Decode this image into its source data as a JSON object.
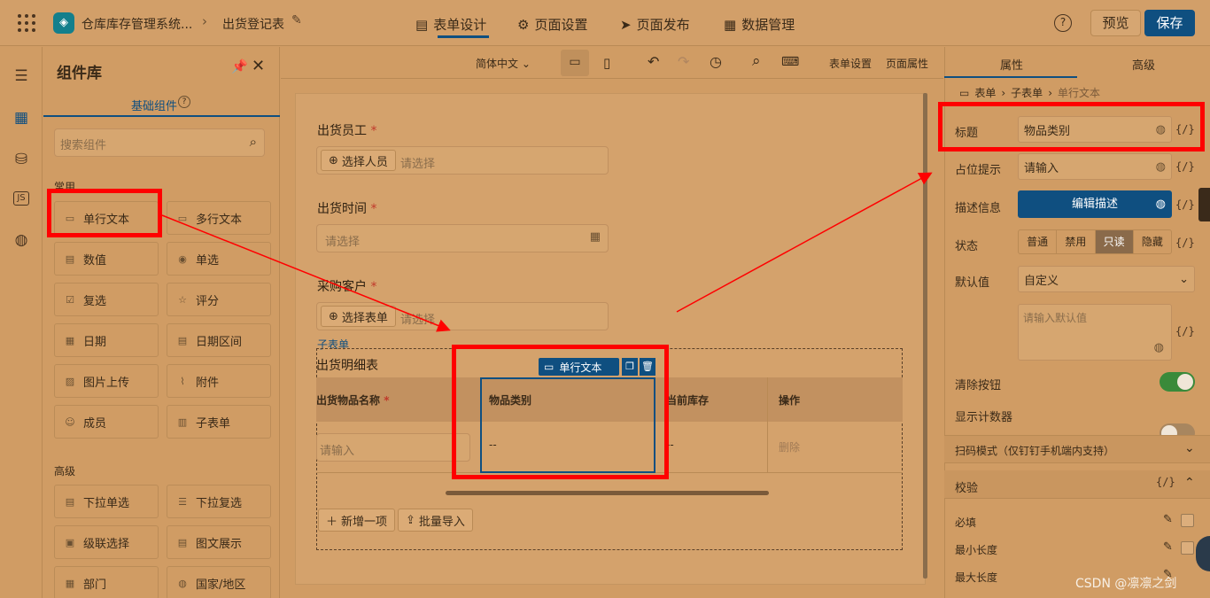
{
  "topbar": {
    "app_name": "仓库库存管理系统...",
    "page_name": "出货登记表",
    "nav": [
      "表单设计",
      "页面设置",
      "页面发布",
      "数据管理"
    ],
    "preview": "预览",
    "save": "保存"
  },
  "library": {
    "title": "组件库",
    "tab": "基础组件",
    "search_placeholder": "搜索组件",
    "section_common": "常用",
    "common": [
      "单行文本",
      "多行文本",
      "数值",
      "单选",
      "复选",
      "评分",
      "日期",
      "日期区间",
      "图片上传",
      "附件",
      "成员",
      "子表单"
    ],
    "section_advanced": "高级",
    "advanced": [
      "下拉单选",
      "下拉复选",
      "级联选择",
      "图文展示",
      "部门",
      "国家/地区"
    ]
  },
  "toolbar": {
    "lang": "简体中文",
    "form_settings": "表单设置",
    "page_props": "页面属性"
  },
  "form": {
    "field1_label": "出货员工",
    "field1_btn": "选择人员",
    "field1_ph": "请选择",
    "field2_label": "出货时间",
    "field2_ph": "请选择",
    "field3_label": "采购客户",
    "field3_btn": "选择表单",
    "field3_ph": "请选择",
    "subform_tag": "子表单",
    "subform_title": "出货明细表",
    "col1": "出货物品名称",
    "col2": "物品类别",
    "col3": "当前库存",
    "col4": "操作",
    "row_ph": "请输入",
    "row_dash": "--",
    "row_dash2": "--",
    "row_delete": "删除",
    "selected_tag": "单行文本",
    "add_item": "新增一项",
    "batch_import": "批量导入"
  },
  "right": {
    "tab_props": "属性",
    "tab_advanced": "高级",
    "crumb": [
      "表单",
      "子表单",
      "单行文本"
    ],
    "title_label": "标题",
    "title_value": "物品类别",
    "placeholder_label": "占位提示",
    "placeholder_value": "请输入",
    "desc_label": "描述信息",
    "desc_btn": "编辑描述",
    "state_label": "状态",
    "states": [
      "普通",
      "禁用",
      "只读",
      "隐藏"
    ],
    "default_label": "默认值",
    "default_select": "自定义",
    "default_ph": "请输入默认值",
    "clear_label": "清除按钮",
    "counter_label": "显示计数器",
    "scan_label": "扫码模式（仅钉钉手机端内支持）",
    "validate_label": "校验",
    "required_label": "必填",
    "minlen_label": "最小长度",
    "maxlen_label": "最大长度",
    "code_glyph": "{/}"
  },
  "watermark": "CSDN @凛凛之剑"
}
